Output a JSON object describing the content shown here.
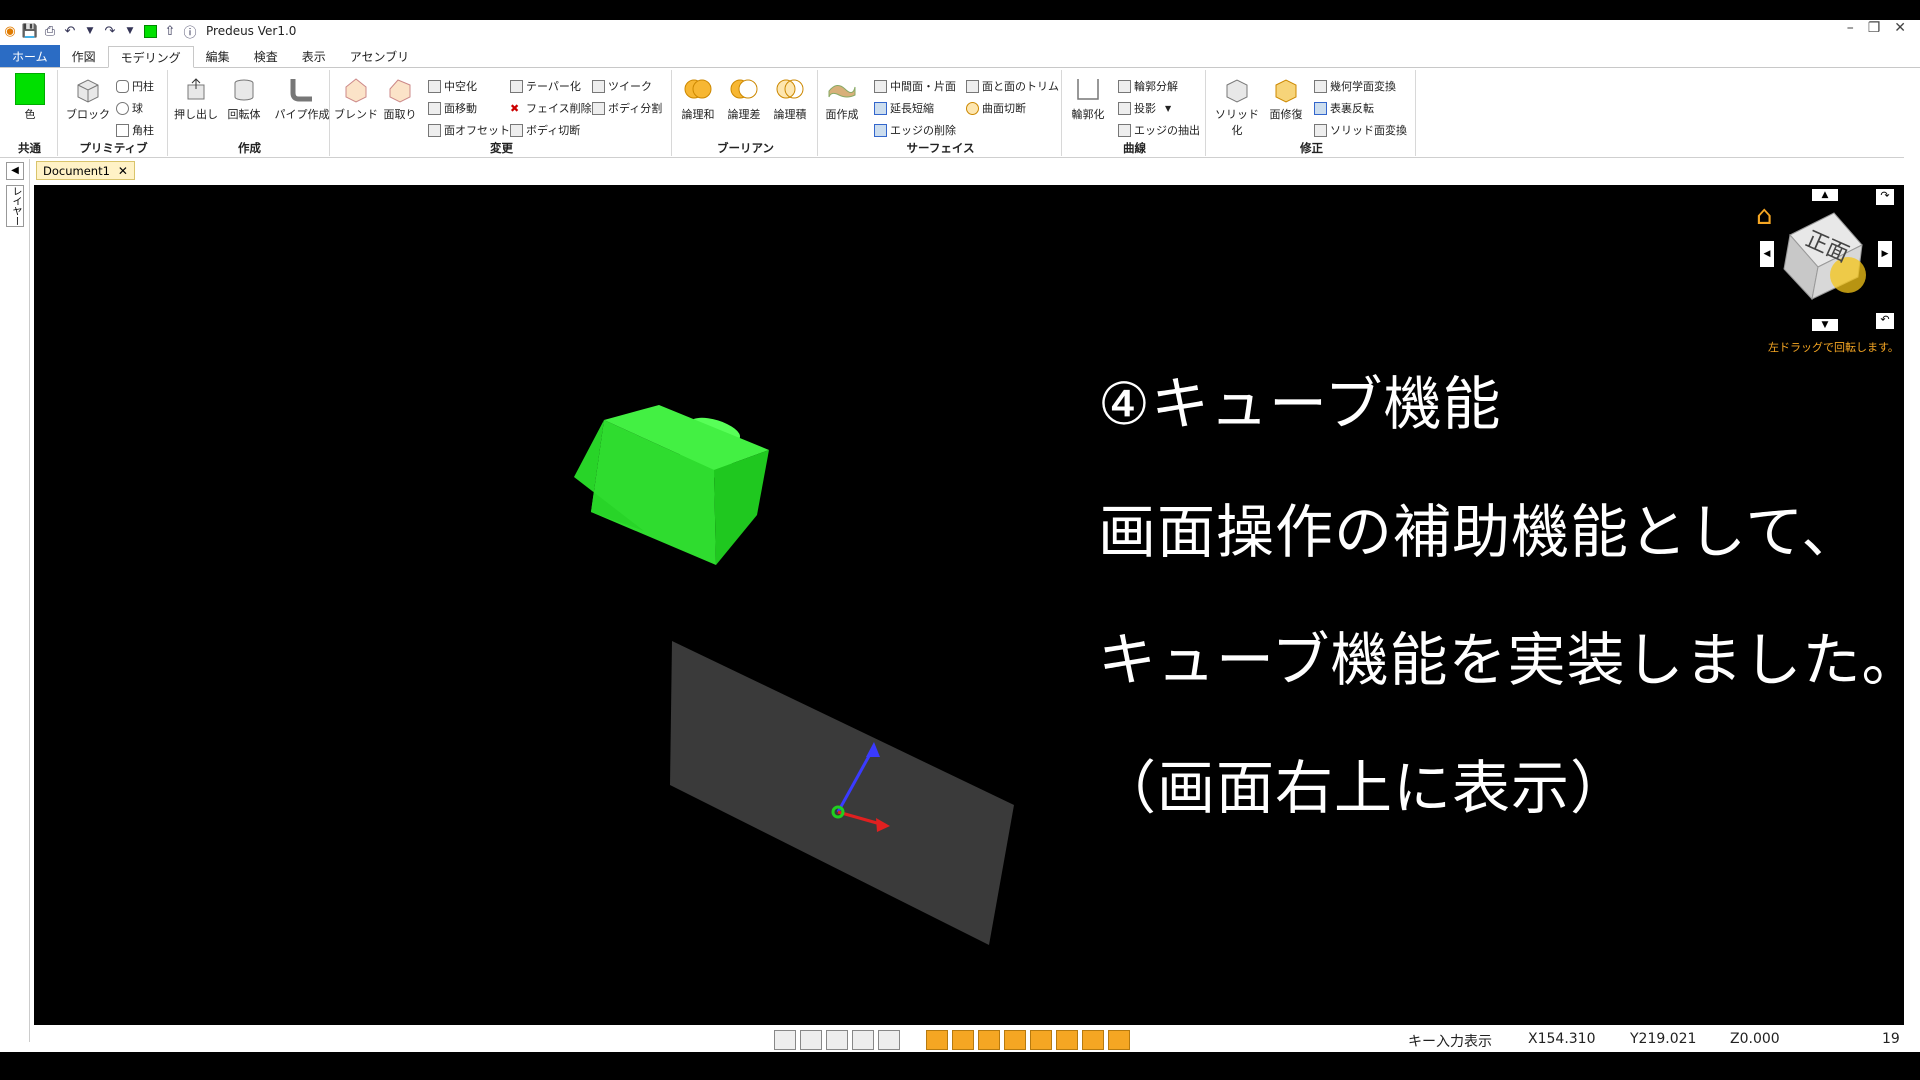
{
  "app": {
    "title": "Predeus Ver1.0"
  },
  "window": {
    "minimize": "–",
    "restore": "❐",
    "close": "✕"
  },
  "tabs": [
    "ホーム",
    "作図",
    "モデリング",
    "編集",
    "検査",
    "表示",
    "アセンブリ"
  ],
  "active_tab": "モデリング",
  "ribbon": {
    "common": {
      "label": "共通",
      "color_btn": "色",
      "color": "#00e000"
    },
    "primitive": {
      "label": "プリミティブ",
      "block": "ブロック",
      "cylinder": "円柱",
      "sphere": "球",
      "cone": "角柱"
    },
    "create": {
      "label": "作成",
      "extrude": "押し出し",
      "revolve": "回転体",
      "pipe": "パイプ作成"
    },
    "modify": {
      "label": "変更",
      "blend": "ブレンド",
      "chamfer": "面取り",
      "hollow": "中空化",
      "move_face": "面移動",
      "offset_face": "面オフセット",
      "taper": "テーパー化",
      "delete_face": "フェイス削除",
      "body_cut": "ボディ切断",
      "tweak": "ツイーク",
      "body_split": "ボディ分割"
    },
    "boolean": {
      "label": "ブーリアン",
      "union": "論理和",
      "subtract": "論理差",
      "intersect": "論理積"
    },
    "surface": {
      "label": "サーフェイス",
      "make_face": "面作成",
      "mid_face": "中間面・片面",
      "extend": "延長短縮",
      "delete_edge": "エッジの削除",
      "trim": "面と面のトリム",
      "curve_cut": "曲面切断"
    },
    "curve": {
      "label": "曲線",
      "outline": "輪郭化",
      "decompose": "輪郭分解",
      "project": "投影",
      "extract_edge": "エッジの抽出"
    },
    "repair": {
      "label": "修正",
      "solidify": "ソリッド化",
      "heal": "面修復",
      "geom_convert": "幾何学面変換",
      "reverse": "表裏反転",
      "solid_convert": "ソリッド面変換"
    }
  },
  "document_tab": "Document1",
  "side_panel": "レイヤー",
  "view_cube": {
    "face": "正面",
    "hint": "左ドラッグで回転します。"
  },
  "caption": {
    "line1": "④キューブ機能",
    "line2": "画面操作の補助機能として、",
    "line3": "キューブ機能を実装しました。",
    "line4": "（画面右上に表示）"
  },
  "status": {
    "key_input": "キー入力表示",
    "x": "X154.310",
    "y": "Y219.021",
    "z": "Z0.000",
    "count": "19"
  }
}
